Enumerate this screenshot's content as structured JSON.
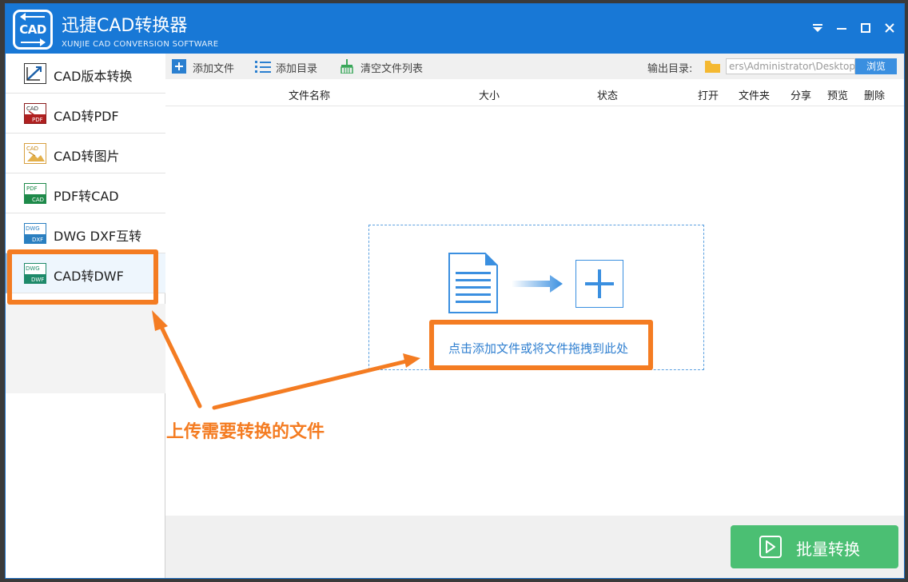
{
  "app": {
    "title": "迅捷CAD转换器",
    "subtitle": "XUNJIE CAD CONVERSION SOFTWARE",
    "logo_text": "CAD"
  },
  "window_controls": [
    "menu-icon",
    "minimize-icon",
    "maximize-icon",
    "close-icon"
  ],
  "sidebar": {
    "items": [
      {
        "label": "CAD版本转换",
        "icon": "version-convert-icon",
        "icon_text": ""
      },
      {
        "label": "CAD转PDF",
        "icon": "cad-to-pdf-icon",
        "icon_text": "CAD PDF"
      },
      {
        "label": "CAD转图片",
        "icon": "cad-to-image-icon",
        "icon_text": "CAD"
      },
      {
        "label": "PDF转CAD",
        "icon": "pdf-to-cad-icon",
        "icon_text": "PDF CAD"
      },
      {
        "label": "DWG DXF互转",
        "icon": "dwg-dxf-icon",
        "icon_text": "DWG DXF"
      },
      {
        "label": "CAD转DWF",
        "icon": "cad-to-dwf-icon",
        "icon_text": "DWG DWF"
      }
    ],
    "active_index": 5
  },
  "toolbar": {
    "add_file": "添加文件",
    "add_folder": "添加目录",
    "clear_list": "清空文件列表",
    "output_label": "输出目录:",
    "output_path": "ers\\Administrator\\Desktop",
    "browse": "浏览"
  },
  "columns": {
    "name": "文件名称",
    "size": "大小",
    "status": "状态",
    "open": "打开",
    "folder": "文件夹",
    "share": "分享",
    "preview": "预览",
    "delete": "删除"
  },
  "dropzone": {
    "hint": "点击添加文件或将文件拖拽到此处"
  },
  "convert_button": "批量转换",
  "annotation": {
    "text": "上传需要转换的文件",
    "color": "#f47c22"
  },
  "colors": {
    "titlebar": "#1878d6",
    "accent": "#3a8fe0",
    "convert": "#4bbf73"
  }
}
